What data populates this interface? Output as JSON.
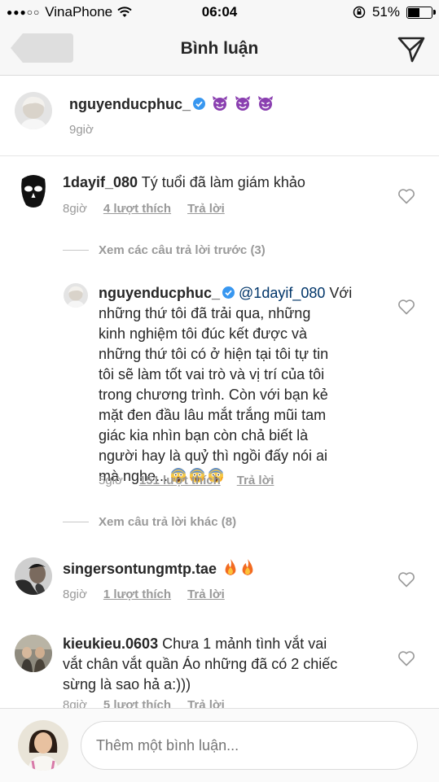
{
  "status_bar": {
    "carrier": "VinaPhone",
    "time": "06:04",
    "battery": "51%",
    "signal_dots": "●●●○○"
  },
  "header": {
    "title": "Bình luận"
  },
  "caption": {
    "username": "nguyenducphuc_",
    "time": "9giờ"
  },
  "comments": [
    {
      "username": "1dayif_080",
      "text": "Tý tuổi đã làm giám khảo",
      "time": "8giờ",
      "likes": "4 lượt thích",
      "reply": "Trả lời"
    },
    {
      "username": "singersontungmtp.tae",
      "text": "",
      "time": "8giờ",
      "likes": "1 lượt thích",
      "reply": "Trả lời"
    },
    {
      "username": "kieukieu.0603",
      "text_line1": "Chưa 1 mảnh tình vắt vai",
      "text_line2": "vắt chân vắt quần Áo những đã có 2 chiếc",
      "text_line3": "sừng là sao hả a:)))",
      "time": "8giờ",
      "likes": "5 lượt thích",
      "reply": "Trả lời"
    }
  ],
  "view_previous": "Xem các câu trả lời trước (3)",
  "view_other": "Xem câu trả lời khác (8)",
  "reply": {
    "username": "nguyenducphuc_",
    "mention": "@1dayif_080",
    "line1_rest": " Với",
    "lines": [
      "những thứ tôi đã trải qua, những",
      "kinh nghiệm tôi đúc kết được và",
      "những thứ tôi có ở hiện tại tôi tự tin",
      "tôi sẽ làm tốt vai trò và vị trí của tôi",
      "trong chương trình. Còn với bạn kẻ",
      "mặt đen đầu lâu mắt trắng mũi tam",
      "giác kia nhìn bạn còn chả biết là",
      "người hay là quỷ thì ngồi đấy nói ai"
    ],
    "last_line": "mà nghe...",
    "time": "5giờ",
    "likes": "151 lượt thích",
    "reply_label": "Trả lời"
  },
  "composer": {
    "placeholder": "Thêm một bình luận..."
  },
  "colors": {
    "verified": "#3897f0",
    "devil": "#8a3fb0",
    "fire": "#f26b21",
    "meta_gray": "#999999"
  },
  "icons": [
    "back-arrow-icon",
    "send-icon",
    "heart-icon",
    "verified-icon",
    "devil-emoji-icon",
    "fire-emoji-icon",
    "scream-emoji-icon",
    "wifi-icon",
    "battery-icon",
    "rotation-lock-icon"
  ]
}
